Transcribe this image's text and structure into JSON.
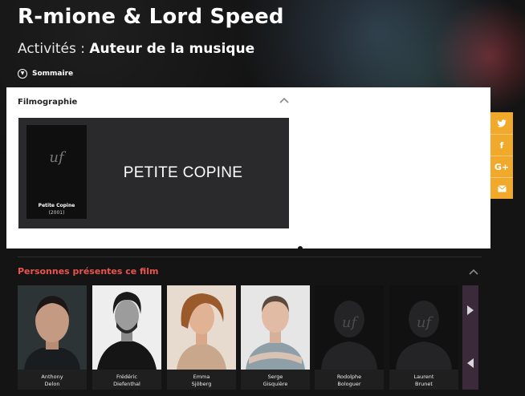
{
  "header": {
    "title": "R-mione & Lord Speed",
    "activities_label": "Activités :",
    "activities_value": "Auteur de la musique",
    "summary_label": "Sommaire"
  },
  "filmography": {
    "title": "Filmographie",
    "film": {
      "title": "Petite Copine",
      "year": "(2001)",
      "banner_text": "PETITE COPINE",
      "logo_text": "uf"
    }
  },
  "social": [
    "twitter-icon",
    "facebook-icon",
    "google-plus-icon",
    "mail-icon"
  ],
  "persons": {
    "title": "Personnes présentes ce film",
    "items": [
      {
        "first": "Anthony",
        "last": "Delon"
      },
      {
        "first": "Frédéric",
        "last": "Diefenthal"
      },
      {
        "first": "Emma",
        "last": "Sjöberg"
      },
      {
        "first": "Serge",
        "last": "Gisquière"
      },
      {
        "first": "Rodolphe",
        "last": "Bologuer"
      },
      {
        "first": "Laurent",
        "last": "Brunet"
      }
    ]
  },
  "colors": {
    "accent": "#f0a92b",
    "section_title": "#e8554f",
    "card": "#2a2a2d"
  }
}
